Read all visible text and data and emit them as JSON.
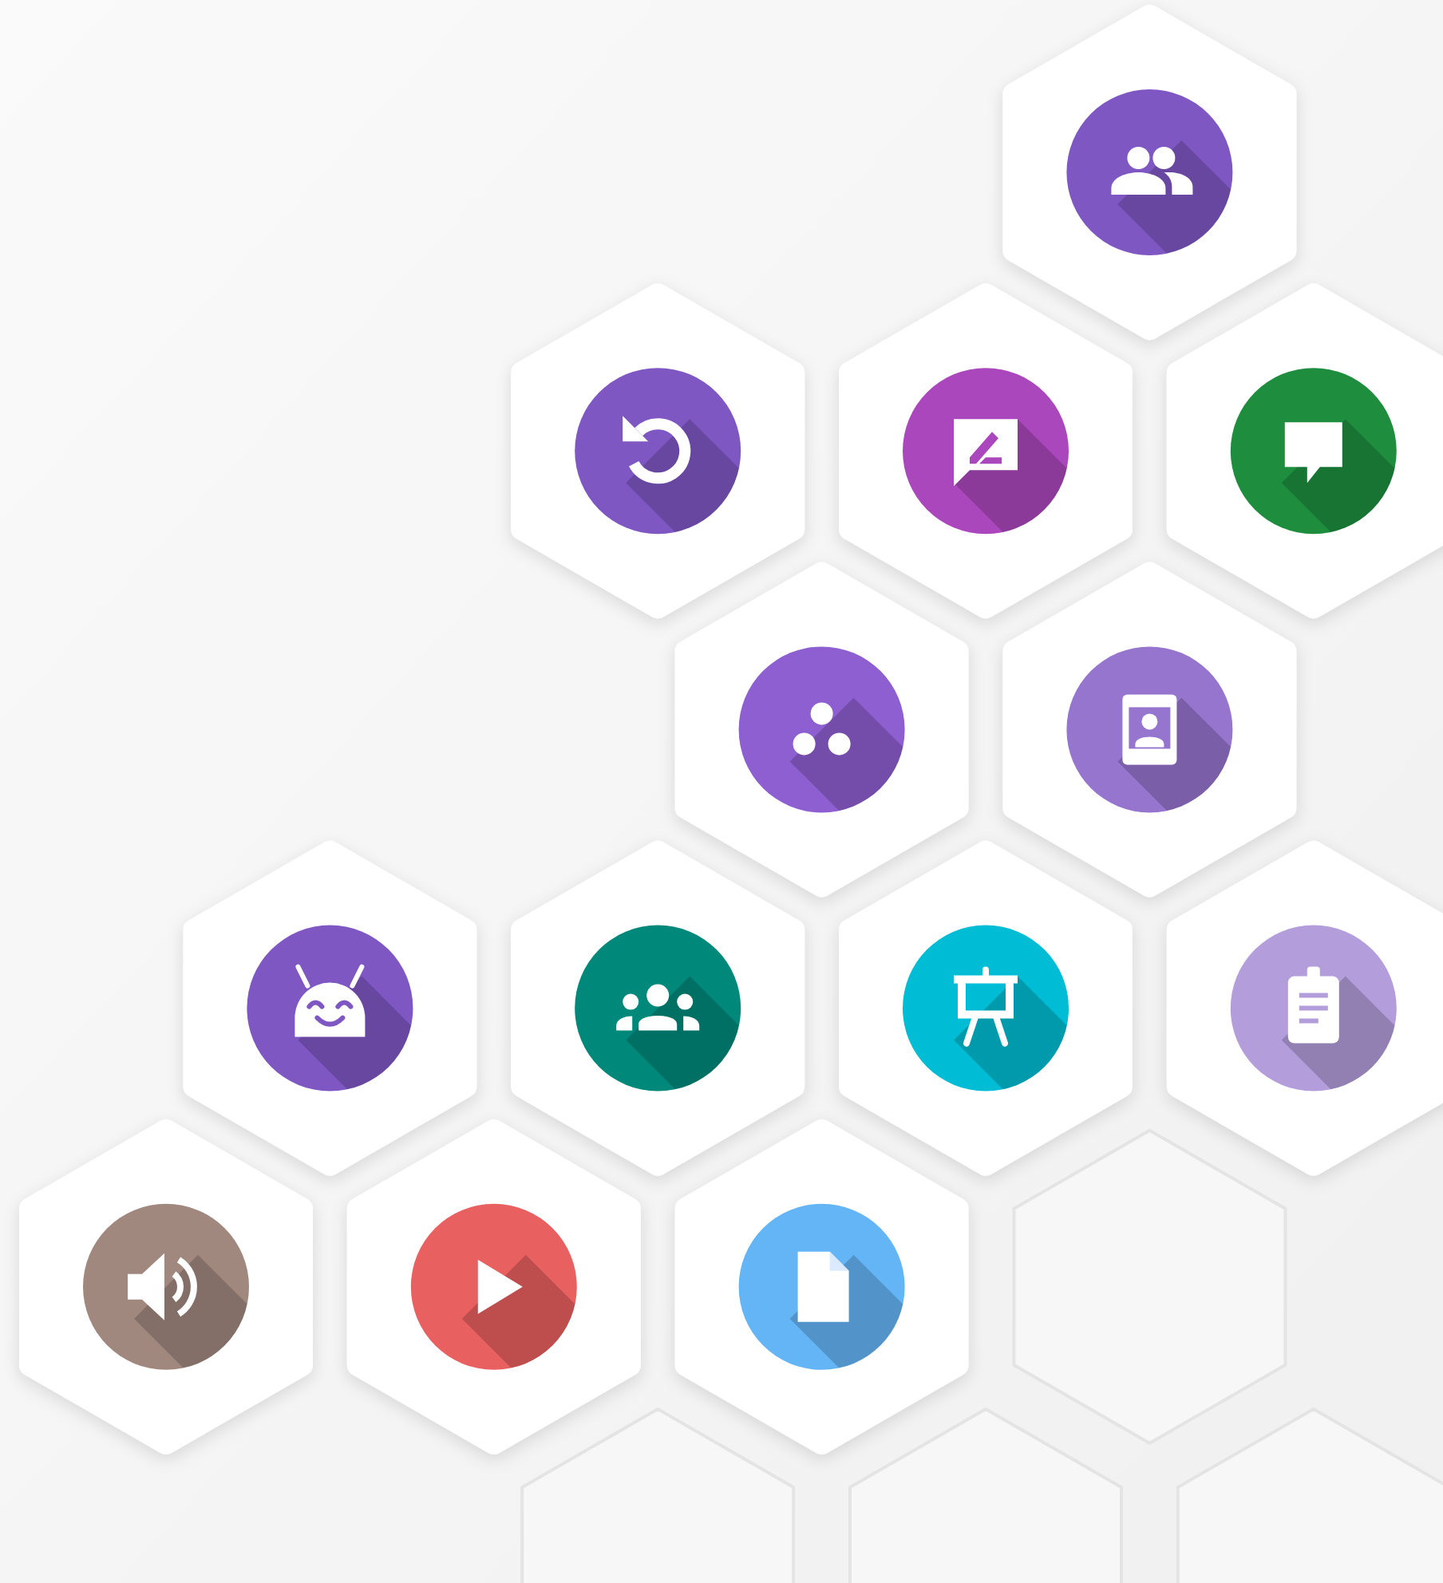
{
  "rows": [
    {
      "cells": [
        {
          "kind": "none"
        },
        {
          "kind": "none"
        },
        {
          "kind": "none"
        },
        {
          "kind": "people",
          "color": "#7e57c2"
        }
      ]
    },
    {
      "cells": [
        {
          "kind": "none"
        },
        {
          "kind": "undo",
          "color": "#7e57c2"
        },
        {
          "kind": "feedback",
          "color": "#ab47bc"
        },
        {
          "kind": "chat",
          "color": "#1e8e3e"
        }
      ]
    },
    {
      "cells": [
        {
          "kind": "none"
        },
        {
          "kind": "none"
        },
        {
          "kind": "dots",
          "color": "#8e5fd0"
        },
        {
          "kind": "contact",
          "color": "#9575cd"
        }
      ]
    },
    {
      "cells": [
        {
          "kind": "android",
          "color": "#7e57c2"
        },
        {
          "kind": "group",
          "color": "#00897b"
        },
        {
          "kind": "easel",
          "color": "#00bcd4"
        },
        {
          "kind": "clipboard",
          "color": "#b39ddb"
        }
      ]
    },
    {
      "cells": [
        {
          "kind": "speaker",
          "color": "#a1887f"
        },
        {
          "kind": "play",
          "color": "#e86060"
        },
        {
          "kind": "file",
          "color": "#64b5f6"
        },
        {
          "kind": "outline"
        }
      ]
    },
    {
      "cells": [
        {
          "kind": "none"
        },
        {
          "kind": "outline"
        },
        {
          "kind": "outline"
        },
        {
          "kind": "outline"
        }
      ]
    }
  ]
}
